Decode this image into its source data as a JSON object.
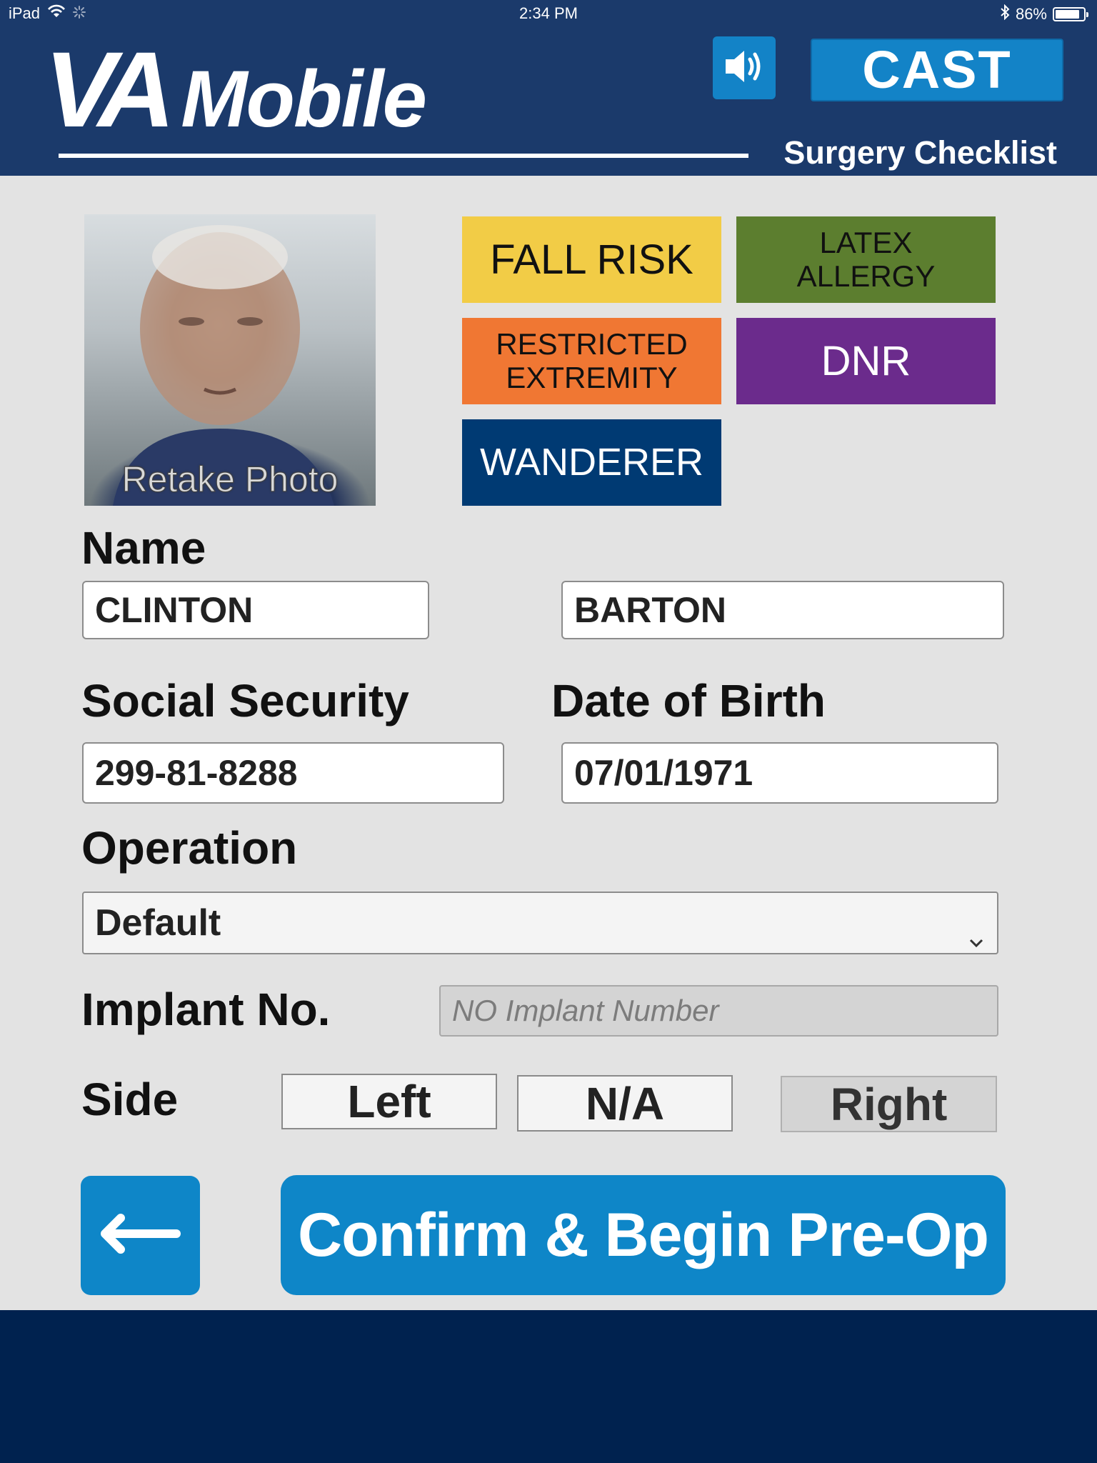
{
  "status_bar": {
    "device": "iPad",
    "time": "2:34 PM",
    "battery": "86%",
    "battery_level": 0.86,
    "icons": [
      "wifi-icon",
      "activity-spinner-icon",
      "bluetooth-icon",
      "battery-icon"
    ]
  },
  "header": {
    "logo_va": "VA",
    "logo_mobile": "Mobile",
    "subtitle": "Surgery Checklist",
    "speaker_icon": "speaker-icon",
    "cast_label": "CAST"
  },
  "photo": {
    "retake_label": "Retake Photo"
  },
  "badges": {
    "fall_risk": "FALL RISK",
    "latex_allergy": [
      "LATEX",
      "ALLERGY"
    ],
    "restricted_extremity": [
      "RESTRICTED",
      "EXTREMITY"
    ],
    "dnr": "DNR",
    "wanderer": "WANDERER",
    "colors": {
      "fall_risk": "#f2cc46",
      "latex_allergy": "#5c7e2f",
      "restricted_extremity": "#f07733",
      "dnr": "#6b2b8c",
      "wanderer": "#003a73"
    }
  },
  "form": {
    "name_label": "Name",
    "first_name": "CLINTON",
    "last_name": "BARTON",
    "ssn_label": "Social Security",
    "ssn": "299-81-8288",
    "dob_label": "Date of Birth",
    "dob": "07/01/1971",
    "operation_label": "Operation",
    "operation_selected": "Default",
    "implant_label": "Implant No.",
    "implant_placeholder": "NO Implant Number",
    "side_label": "Side",
    "side_options": [
      "Left",
      "N/A",
      "Right"
    ],
    "side_selected": "Right"
  },
  "actions": {
    "back_icon": "left-arrow-icon",
    "confirm_label": "Confirm & Begin Pre-Op"
  },
  "colors": {
    "header_bg": "#1b3a6b",
    "footer_bg": "#00224f",
    "accent_blue": "#0e86c8",
    "panel_bg": "#e3e3e3"
  }
}
